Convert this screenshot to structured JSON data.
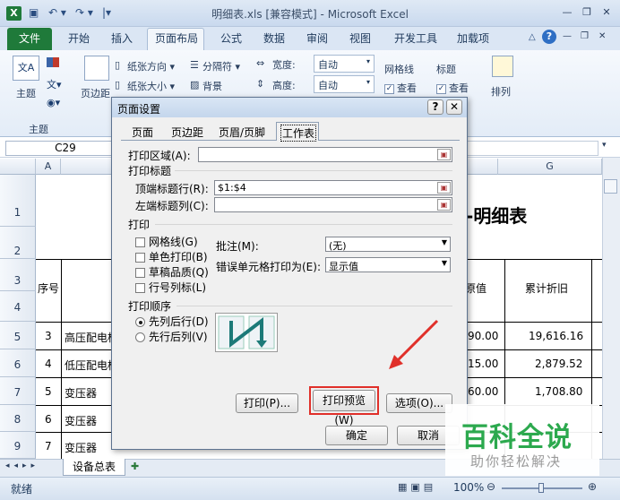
{
  "window": {
    "title": "明细表.xls [兼容模式] - Microsoft Excel",
    "qat_save": "▣",
    "qat_undo": "↶ ▾",
    "qat_redo": "↷ ▾",
    "qat_more": "|▾",
    "min": "—",
    "restore": "❐",
    "close": "✕",
    "app_icon": "X"
  },
  "ribbon": {
    "tabs": [
      "文件",
      "开始",
      "插入",
      "页面布局",
      "公式",
      "数据",
      "审阅",
      "视图",
      "开发工具",
      "加载项"
    ],
    "help_glyph": "?",
    "theme_label": "主题",
    "theme_group": "主题",
    "margins_label": "页边距",
    "orientation": "纸张方向 ▾",
    "size": "纸张大小 ▾",
    "breaks": "分隔符 ▾",
    "background": "背景",
    "width_label": "宽度:",
    "width_value": "自动",
    "height_label": "高度:",
    "height_value": "自动",
    "gridlines_label": "网格线",
    "gridlines_view": "查看",
    "headings_label": "标题",
    "headings_view": "查看",
    "arrange": "排列"
  },
  "formula": {
    "name_box": "C29"
  },
  "sheet": {
    "columns": [
      "A",
      "G"
    ],
    "rows": [
      "1",
      "2",
      "3",
      "4",
      "5",
      "6",
      "7",
      "8",
      "9"
    ],
    "title_partial": "明细表",
    "header_seq": "序号",
    "header_value": "原值",
    "header_dep": "累计折旧",
    "data": [
      {
        "seq": "3",
        "name": "高压配电柜",
        "value": "90.00",
        "dep": "19,616.16"
      },
      {
        "seq": "4",
        "name": "低压配电柜",
        "value": "15.00",
        "dep": "2,879.52"
      },
      {
        "seq": "5",
        "name": "变压器",
        "value": "60.00",
        "dep": "1,708.80"
      },
      {
        "seq": "6",
        "name": "变压器",
        "value": "",
        "dep": ""
      },
      {
        "seq": "7",
        "name": "变压器",
        "value": "",
        "dep": ""
      }
    ],
    "sheet_tab": "设备总表"
  },
  "status": {
    "ready": "就绪",
    "zoom": "100%"
  },
  "dialog": {
    "title": "页面设置",
    "help": "?",
    "close": "✕",
    "tabs": [
      "页面",
      "页边距",
      "页眉/页脚",
      "工作表"
    ],
    "print_area_label": "打印区域(A):",
    "print_titles_group": "打印标题",
    "top_rows_label": "顶端标题行(R):",
    "top_rows_value": "$1:$4",
    "left_cols_label": "左端标题列(C):",
    "print_group": "打印",
    "opt_gridlines": "网格线(G)",
    "opt_mono": "单色打印(B)",
    "opt_draft": "草稿品质(Q)",
    "opt_rowcol": "行号列标(L)",
    "comments_label": "批注(M):",
    "comments_value": "(无)",
    "errors_label": "错误单元格打印为(E):",
    "errors_value": "显示值",
    "order_group": "打印顺序",
    "order_down": "先列后行(D)",
    "order_over": "先行后列(V)",
    "print_btn": "打印(P)...",
    "preview_btn": "打印预览(W)",
    "options_btn": "选项(O)...",
    "ok_btn": "确定",
    "cancel_btn": "取消"
  },
  "watermark": {
    "brand": "百科全说",
    "slogan": "助你轻松解决"
  },
  "colors": {
    "excel_green": "#1f7a3a",
    "highlight_red": "#e0302a",
    "watermark_green": "#2ca94e"
  }
}
